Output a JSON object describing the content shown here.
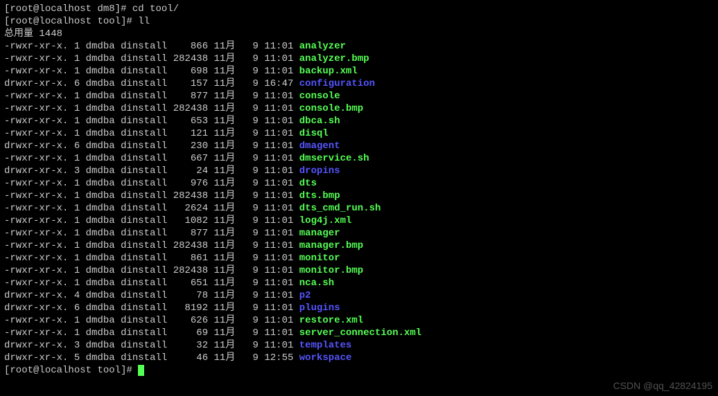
{
  "prompt1": {
    "user": "root",
    "host": "localhost",
    "cwd": "dm8",
    "symbol": "#",
    "command": "cd tool/"
  },
  "prompt2": {
    "user": "root",
    "host": "localhost",
    "cwd": "tool",
    "symbol": "#",
    "command": "ll"
  },
  "total_line": "总用量 1448",
  "listing": [
    {
      "perms": "-rwxr-xr-x.",
      "links": "1",
      "owner": "dmdba",
      "group": "dinstall",
      "size": "866",
      "month": "11月",
      "day": "9",
      "time": "11:01",
      "name": "analyzer",
      "type": "exec"
    },
    {
      "perms": "-rwxr-xr-x.",
      "links": "1",
      "owner": "dmdba",
      "group": "dinstall",
      "size": "282438",
      "month": "11月",
      "day": "9",
      "time": "11:01",
      "name": "analyzer.bmp",
      "type": "exec"
    },
    {
      "perms": "-rwxr-xr-x.",
      "links": "1",
      "owner": "dmdba",
      "group": "dinstall",
      "size": "698",
      "month": "11月",
      "day": "9",
      "time": "11:01",
      "name": "backup.xml",
      "type": "exec"
    },
    {
      "perms": "drwxr-xr-x.",
      "links": "6",
      "owner": "dmdba",
      "group": "dinstall",
      "size": "157",
      "month": "11月",
      "day": "9",
      "time": "16:47",
      "name": "configuration",
      "type": "dir"
    },
    {
      "perms": "-rwxr-xr-x.",
      "links": "1",
      "owner": "dmdba",
      "group": "dinstall",
      "size": "877",
      "month": "11月",
      "day": "9",
      "time": "11:01",
      "name": "console",
      "type": "exec"
    },
    {
      "perms": "-rwxr-xr-x.",
      "links": "1",
      "owner": "dmdba",
      "group": "dinstall",
      "size": "282438",
      "month": "11月",
      "day": "9",
      "time": "11:01",
      "name": "console.bmp",
      "type": "exec"
    },
    {
      "perms": "-rwxr-xr-x.",
      "links": "1",
      "owner": "dmdba",
      "group": "dinstall",
      "size": "653",
      "month": "11月",
      "day": "9",
      "time": "11:01",
      "name": "dbca.sh",
      "type": "exec"
    },
    {
      "perms": "-rwxr-xr-x.",
      "links": "1",
      "owner": "dmdba",
      "group": "dinstall",
      "size": "121",
      "month": "11月",
      "day": "9",
      "time": "11:01",
      "name": "disql",
      "type": "exec"
    },
    {
      "perms": "drwxr-xr-x.",
      "links": "6",
      "owner": "dmdba",
      "group": "dinstall",
      "size": "230",
      "month": "11月",
      "day": "9",
      "time": "11:01",
      "name": "dmagent",
      "type": "dir"
    },
    {
      "perms": "-rwxr-xr-x.",
      "links": "1",
      "owner": "dmdba",
      "group": "dinstall",
      "size": "667",
      "month": "11月",
      "day": "9",
      "time": "11:01",
      "name": "dmservice.sh",
      "type": "exec"
    },
    {
      "perms": "drwxr-xr-x.",
      "links": "3",
      "owner": "dmdba",
      "group": "dinstall",
      "size": "24",
      "month": "11月",
      "day": "9",
      "time": "11:01",
      "name": "dropins",
      "type": "dir"
    },
    {
      "perms": "-rwxr-xr-x.",
      "links": "1",
      "owner": "dmdba",
      "group": "dinstall",
      "size": "976",
      "month": "11月",
      "day": "9",
      "time": "11:01",
      "name": "dts",
      "type": "exec"
    },
    {
      "perms": "-rwxr-xr-x.",
      "links": "1",
      "owner": "dmdba",
      "group": "dinstall",
      "size": "282438",
      "month": "11月",
      "day": "9",
      "time": "11:01",
      "name": "dts.bmp",
      "type": "exec"
    },
    {
      "perms": "-rwxr-xr-x.",
      "links": "1",
      "owner": "dmdba",
      "group": "dinstall",
      "size": "2624",
      "month": "11月",
      "day": "9",
      "time": "11:01",
      "name": "dts_cmd_run.sh",
      "type": "exec"
    },
    {
      "perms": "-rwxr-xr-x.",
      "links": "1",
      "owner": "dmdba",
      "group": "dinstall",
      "size": "1082",
      "month": "11月",
      "day": "9",
      "time": "11:01",
      "name": "log4j.xml",
      "type": "exec"
    },
    {
      "perms": "-rwxr-xr-x.",
      "links": "1",
      "owner": "dmdba",
      "group": "dinstall",
      "size": "877",
      "month": "11月",
      "day": "9",
      "time": "11:01",
      "name": "manager",
      "type": "exec"
    },
    {
      "perms": "-rwxr-xr-x.",
      "links": "1",
      "owner": "dmdba",
      "group": "dinstall",
      "size": "282438",
      "month": "11月",
      "day": "9",
      "time": "11:01",
      "name": "manager.bmp",
      "type": "exec"
    },
    {
      "perms": "-rwxr-xr-x.",
      "links": "1",
      "owner": "dmdba",
      "group": "dinstall",
      "size": "861",
      "month": "11月",
      "day": "9",
      "time": "11:01",
      "name": "monitor",
      "type": "exec"
    },
    {
      "perms": "-rwxr-xr-x.",
      "links": "1",
      "owner": "dmdba",
      "group": "dinstall",
      "size": "282438",
      "month": "11月",
      "day": "9",
      "time": "11:01",
      "name": "monitor.bmp",
      "type": "exec"
    },
    {
      "perms": "-rwxr-xr-x.",
      "links": "1",
      "owner": "dmdba",
      "group": "dinstall",
      "size": "651",
      "month": "11月",
      "day": "9",
      "time": "11:01",
      "name": "nca.sh",
      "type": "exec"
    },
    {
      "perms": "drwxr-xr-x.",
      "links": "4",
      "owner": "dmdba",
      "group": "dinstall",
      "size": "78",
      "month": "11月",
      "day": "9",
      "time": "11:01",
      "name": "p2",
      "type": "dir"
    },
    {
      "perms": "drwxr-xr-x.",
      "links": "6",
      "owner": "dmdba",
      "group": "dinstall",
      "size": "8192",
      "month": "11月",
      "day": "9",
      "time": "11:01",
      "name": "plugins",
      "type": "dir"
    },
    {
      "perms": "-rwxr-xr-x.",
      "links": "1",
      "owner": "dmdba",
      "group": "dinstall",
      "size": "626",
      "month": "11月",
      "day": "9",
      "time": "11:01",
      "name": "restore.xml",
      "type": "exec"
    },
    {
      "perms": "-rwxr-xr-x.",
      "links": "1",
      "owner": "dmdba",
      "group": "dinstall",
      "size": "69",
      "month": "11月",
      "day": "9",
      "time": "11:01",
      "name": "server_connection.xml",
      "type": "exec"
    },
    {
      "perms": "drwxr-xr-x.",
      "links": "3",
      "owner": "dmdba",
      "group": "dinstall",
      "size": "32",
      "month": "11月",
      "day": "9",
      "time": "11:01",
      "name": "templates",
      "type": "dir"
    },
    {
      "perms": "drwxr-xr-x.",
      "links": "5",
      "owner": "dmdba",
      "group": "dinstall",
      "size": "46",
      "month": "11月",
      "day": "9",
      "time": "12:55",
      "name": "workspace",
      "type": "dir"
    }
  ],
  "prompt3": {
    "user": "root",
    "host": "localhost",
    "cwd": "tool",
    "symbol": "#"
  },
  "watermark": "CSDN @qq_42824195"
}
